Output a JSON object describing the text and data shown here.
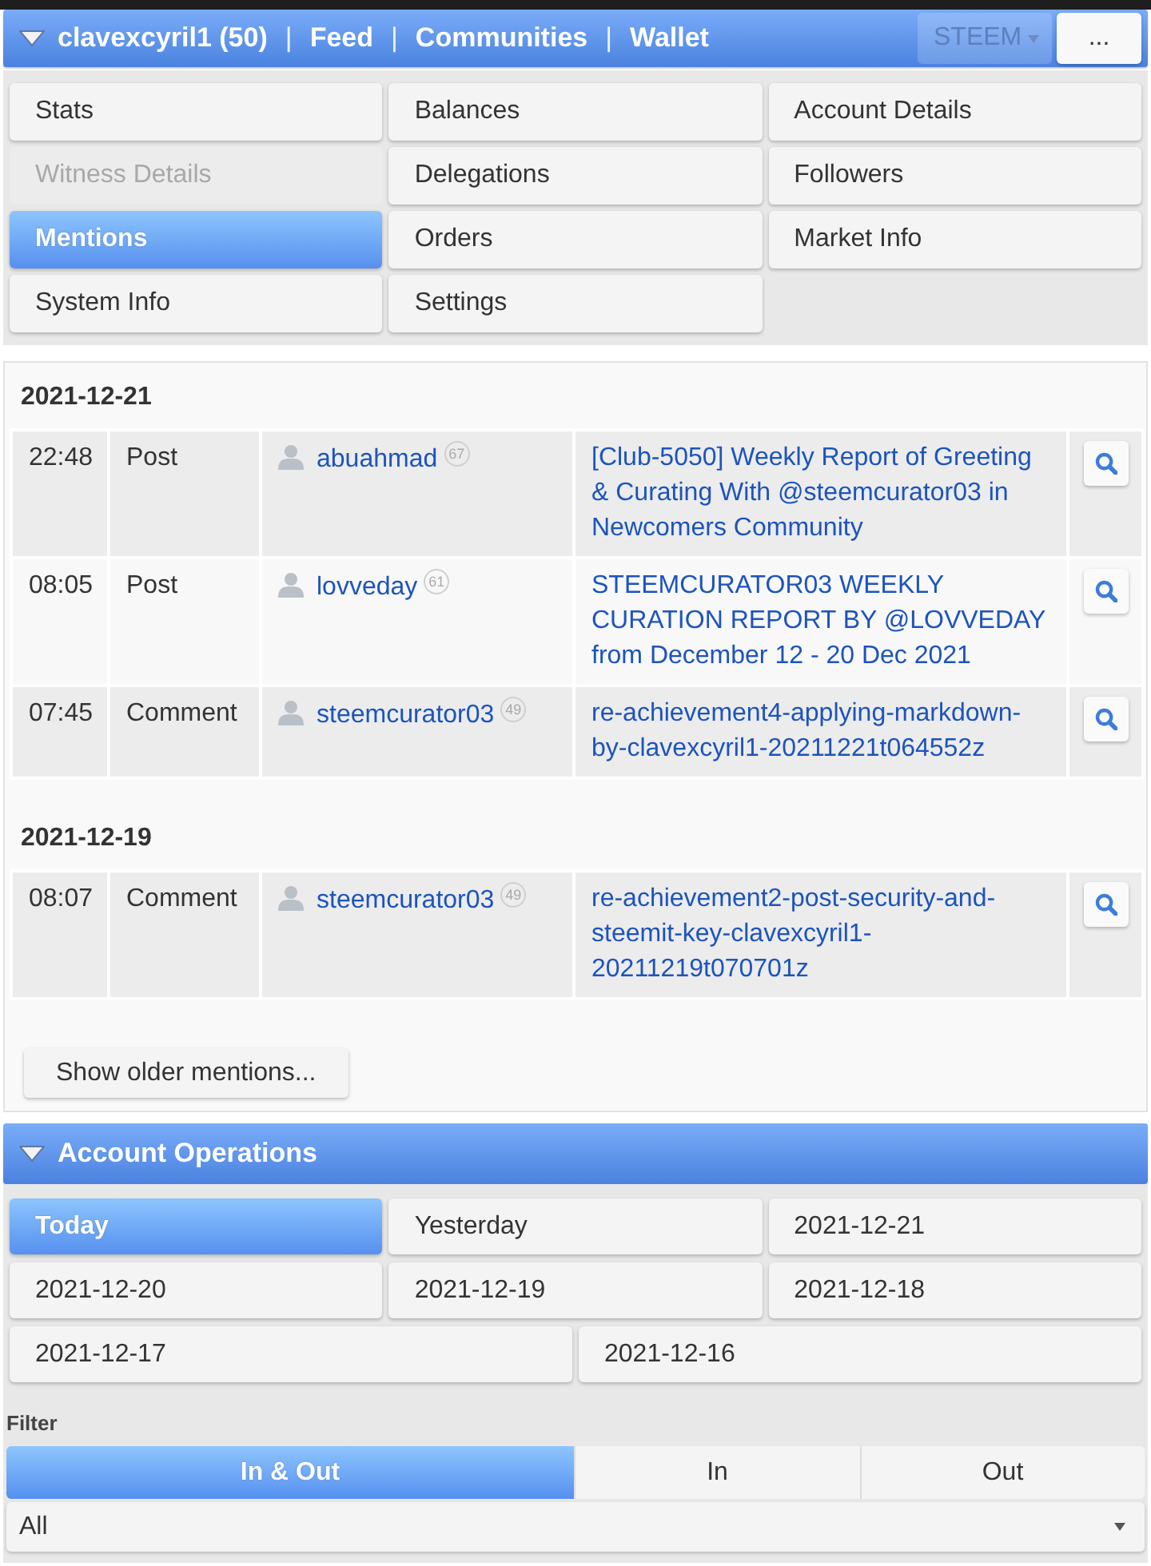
{
  "top_bar": {
    "expanded": true,
    "items": [
      {
        "kind": "link",
        "label": "clavexcyril1 (50)"
      },
      {
        "kind": "separator",
        "label": "|"
      },
      {
        "kind": "link",
        "label": "Feed"
      },
      {
        "kind": "separator",
        "label": "|"
      },
      {
        "kind": "link",
        "label": "Communities"
      },
      {
        "kind": "separator",
        "label": "|"
      },
      {
        "kind": "link",
        "label": "Wallet"
      }
    ],
    "currency_select": {
      "value": "STEEM",
      "disabled": true
    },
    "more_button": "..."
  },
  "menu": {
    "items": [
      {
        "label": "Stats",
        "selected": false,
        "disabled": false
      },
      {
        "label": "Balances",
        "selected": false,
        "disabled": false
      },
      {
        "label": "Account Details",
        "selected": false,
        "disabled": false
      },
      {
        "label": "Witness Details",
        "selected": false,
        "disabled": true
      },
      {
        "label": "Delegations",
        "selected": false,
        "disabled": false
      },
      {
        "label": "Followers",
        "selected": false,
        "disabled": false
      },
      {
        "label": "Mentions",
        "selected": true,
        "disabled": false
      },
      {
        "label": "Orders",
        "selected": false,
        "disabled": false
      },
      {
        "label": "Market Info",
        "selected": false,
        "disabled": false
      },
      {
        "label": "System Info",
        "selected": false,
        "disabled": false
      },
      {
        "label": "Settings",
        "selected": false,
        "disabled": false
      }
    ]
  },
  "mentions": {
    "groups": [
      {
        "date": "2021-12-21",
        "rows": [
          {
            "time": "22:48",
            "type": "Post",
            "user": "abuahmad",
            "reputation": "67",
            "title": "[Club-5050] Weekly Report of Greeting & Curating With @steemcurator03 in Newcomers Community"
          },
          {
            "time": "08:05",
            "type": "Post",
            "user": "lovveday",
            "reputation": "61",
            "title": "STEEMCURATOR03 WEEKLY CURATION REPORT BY @LOVVEDAY from December 12 - 20 Dec 2021"
          },
          {
            "time": "07:45",
            "type": "Comment",
            "user": "steemcurator03",
            "reputation": "49",
            "title": "re-achievement4-applying-markdown-by-clavexcyril1-20211221t064552z"
          }
        ]
      },
      {
        "date": "2021-12-19",
        "rows": [
          {
            "time": "08:07",
            "type": "Comment",
            "user": "steemcurator03",
            "reputation": "49",
            "title": "re-achievement2-post-security-and-steemit-key-clavexcyril1-20211219t070701z"
          }
        ]
      }
    ],
    "more_button": "Show older mentions..."
  },
  "account_operations": {
    "title": "Account Operations",
    "expanded": true,
    "days": [
      {
        "label": "Today",
        "selected": true
      },
      {
        "label": "Yesterday",
        "selected": false
      },
      {
        "label": "2021-12-21",
        "selected": false
      },
      {
        "label": "2021-12-20",
        "selected": false
      },
      {
        "label": "2021-12-19",
        "selected": false
      },
      {
        "label": "2021-12-18",
        "selected": false
      },
      {
        "label": "2021-12-17",
        "selected": false
      },
      {
        "label": "2021-12-16",
        "selected": false
      }
    ],
    "filter": {
      "label": "Filter",
      "direction_tabs": [
        {
          "label": "In & Out",
          "selected": true
        },
        {
          "label": "In",
          "selected": false
        },
        {
          "label": "Out",
          "selected": false
        }
      ],
      "type_select": {
        "value": "All"
      }
    }
  }
}
